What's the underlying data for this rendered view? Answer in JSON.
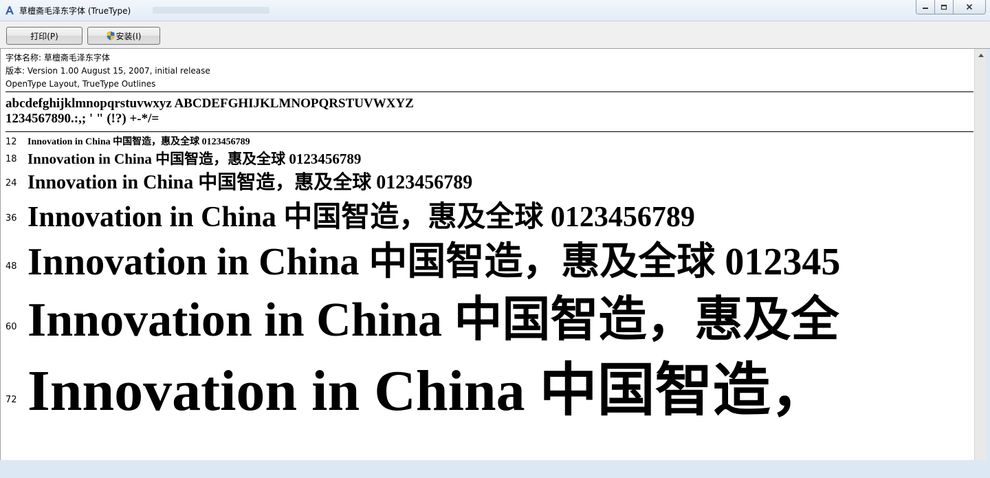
{
  "window": {
    "title": "草檀斋毛泽东字体 (TrueType)"
  },
  "toolbar": {
    "print_label": "打印(P)",
    "install_label": "安装(I)"
  },
  "info": {
    "font_name": "字体名称: 草檀斋毛泽东字体",
    "version": "版本: Version 1.00 August 15, 2007, initial release",
    "format": "OpenType Layout, TrueType Outlines"
  },
  "charset": {
    "line1": "abcdefghijklmnopqrstuvwxyz ABCDEFGHIJKLMNOPQRSTUVWXYZ",
    "line2": "1234567890.:,; ' \" (!?) +-*/="
  },
  "samples": [
    {
      "size": "12",
      "text": "Innovation in China 中国智造，惠及全球 0123456789"
    },
    {
      "size": "18",
      "text": "Innovation in China 中国智造，惠及全球 0123456789"
    },
    {
      "size": "24",
      "text": "Innovation in China 中国智造，惠及全球 0123456789"
    },
    {
      "size": "36",
      "text": "Innovation in China 中国智造，惠及全球 0123456789"
    },
    {
      "size": "48",
      "text": "Innovation in China 中国智造，惠及全球 012345"
    },
    {
      "size": "60",
      "text": "Innovation in China 中国智造，惠及全"
    },
    {
      "size": "72",
      "text": "Innovation in China 中国智造，"
    }
  ]
}
